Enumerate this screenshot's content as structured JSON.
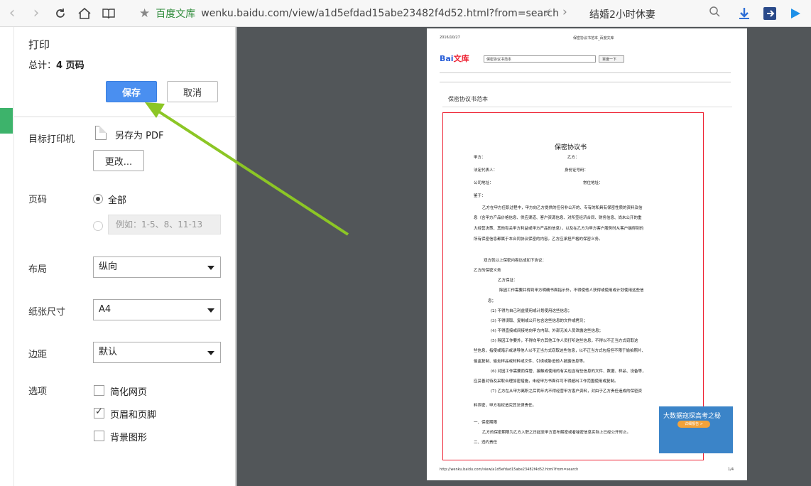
{
  "browser": {
    "site_name": "百度文库",
    "url": "wenku.baidu.com/view/a1d5efdad15abe23482f4d52.html?from=search",
    "search_text": "结婚2小时休妻"
  },
  "dialog": {
    "title": "打印",
    "total_prefix": "总计：",
    "total_pages": "4 页码",
    "save_label": "保存",
    "cancel_label": "取消",
    "destination_label": "目标打印机",
    "destination_value": "另存为 PDF",
    "change_label": "更改...",
    "pages_label": "页码",
    "pages_all": "全部",
    "pages_placeholder": "例如：1-5、8、11-13",
    "layout_label": "布局",
    "layout_value": "纵向",
    "paper_label": "纸张尺寸",
    "paper_value": "A4",
    "margin_label": "边距",
    "margin_value": "默认",
    "options_label": "选项",
    "opt_simplify": "简化网页",
    "opt_simplify_checked": false,
    "opt_headers": "页眉和页脚",
    "opt_headers_checked": true,
    "opt_background": "背景图形",
    "opt_background_checked": false
  },
  "preview": {
    "header_date": "2016/10/27",
    "header_title": "保密协议书范本_百度文库",
    "logo_text": "Bai",
    "logo_brand": "文库",
    "search_box": "保密协议书范本",
    "search_button": "百度一下",
    "doc_heading": "保密协议书范本",
    "doc_title": "保密协议书",
    "field_a": "甲方：",
    "field_b": "乙方：",
    "field_rep": "法定代表人：",
    "field_id": "身份证号码：",
    "field_addr": "公司地址：",
    "field_home": "常住地址：",
    "field_seeing": "鉴于：",
    "para1": "乙方在甲方任职过程中，甲方向乙方提供的任何非公开的、专有的和具有保密性质的资料及信",
    "para2": "息（含甲方产品价格信息、供应渠道、客户资源信息、对所签经济合同、财务信息、尚未公开的重",
    "para3": "大经营决策、其他有关甲方利益或甲方产品的信息），以及在乙方为甲方客户服务时从客户端得到的",
    "para4": "所有保密信息都属于本合同协议保密的内容。乙方应承担严格的保密义务。",
    "para5": "双方就以上保密内容达成如下协议：",
    "para6": "乙方的保密义务",
    "para7": "乙方保证：",
    "para8": "除因工作需要并得到甲方明确书面指示外，不得使他人获得或使用或计划使用这些信",
    "para9": "息；",
    "para10": "(2)  不得为自己利益使用或计划使用这些信息；",
    "para11": "(3)  不得误取、复制或公开包含这些信息的文件或拷贝；",
    "para12": "(4)  不得直接或间接地向甲方内部、外部无关人员泄露这些信息；",
    "para13": "(5)  除因工作要外，不得向甲方其他工作人员打听这些信息，不得以不正当方式窃取这",
    "para14": "些信息，指使或暗示或诱导他人以不正当方式窃取这些信息，以不正当方式包括但不限于偷拍照片、",
    "para15": "偷盗复制、偷走样品或材料或文件、引诱或胁迫他人披露信息等。",
    "para16": "(6)  对因工作需要而保管、接触或使用的有关包含有些信息的文件、数据、样品、设备等，",
    "para17": "应妥善对待及采取合理加密措施，未经甲方书面许可不得超出工作范围使用或复制。",
    "para18": "(7)  乙方在从甲方离职之后两年内不得经营甲方客户资料，对由于乙方责任造成的保密资",
    "para19": "料泄密，甲方有权追究其法律责任。",
    "para20": "一、保密期限",
    "para21": "乙方的保密期限为乙方入职之日起至甲方宣布解密或者秘密信息实际上已经公开时止。",
    "para22": "二、违约责任",
    "footer_url": "http://wenku.baidu.com/view/a1d5efdad15abe23482f4d52.html?from=search",
    "footer_page": "1/4",
    "ad_text": "大数据寇探高考之秘",
    "ad_button": "详细报告 >"
  }
}
